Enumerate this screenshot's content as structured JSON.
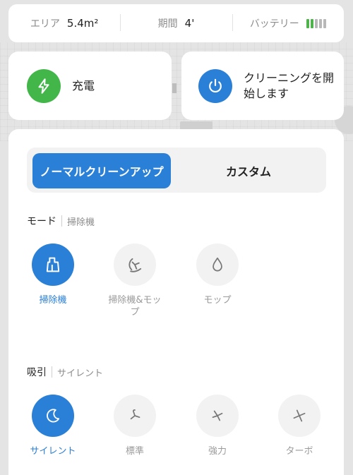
{
  "stats": {
    "area_label": "エリア",
    "area_value": "5.4m²",
    "period_label": "期間",
    "period_value": "4'",
    "battery_label": "バッテリー",
    "battery_level": 0.4
  },
  "actions": {
    "charge_label": "充電",
    "start_label": "クリーニングを開始します"
  },
  "tabs": {
    "normal": "ノーマルクリーンアップ",
    "custom": "カスタム",
    "active": "normal"
  },
  "mode": {
    "title": "モード",
    "current": "掃除機",
    "options": [
      {
        "label": "掃除機",
        "icon": "vacuum-icon",
        "selected": true
      },
      {
        "label": "掃除機&モップ",
        "icon": "vacuum-mop-icon",
        "selected": false
      },
      {
        "label": "モップ",
        "icon": "water-drop-icon",
        "selected": false
      }
    ]
  },
  "suction": {
    "title": "吸引",
    "current": "サイレント",
    "options": [
      {
        "label": "サイレント",
        "icon": "moon-icon",
        "selected": true
      },
      {
        "label": "標準",
        "icon": "fan-icon",
        "selected": false
      },
      {
        "label": "強力",
        "icon": "fan-icon",
        "selected": false
      },
      {
        "label": "ターボ",
        "icon": "fan-icon",
        "selected": false
      }
    ]
  },
  "colors": {
    "accent": "#2a7fd6",
    "charge": "#43b649",
    "battery_on": "#4db34a"
  }
}
